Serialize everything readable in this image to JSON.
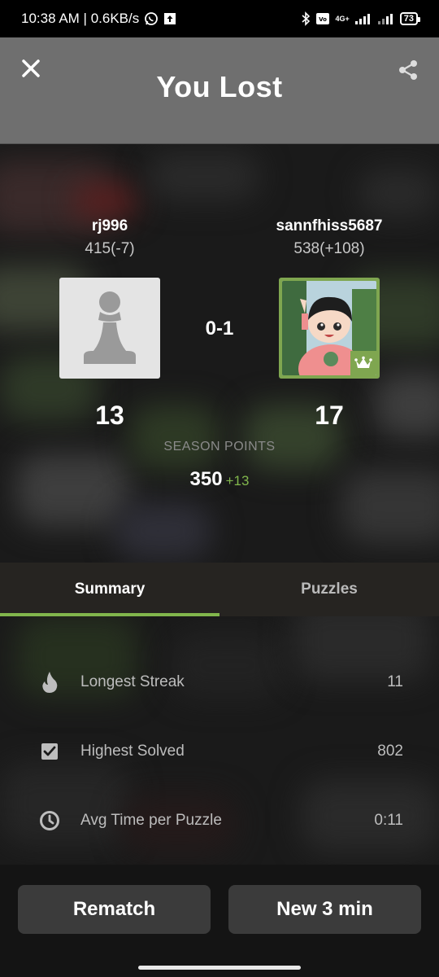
{
  "status_bar": {
    "time_speed": "10:38 AM | 0.6KB/s",
    "network": "4G+",
    "battery": "73"
  },
  "header": {
    "title": "You Lost"
  },
  "players": {
    "left": {
      "name": "rj996",
      "rating": "415(-7)",
      "points": "13",
      "avatar_icon": "pawn-icon"
    },
    "right": {
      "name": "sannfhiss5687",
      "rating": "538(+108)",
      "points": "17",
      "badge_icon": "crown-icon"
    }
  },
  "score": "0-1",
  "season": {
    "label": "SEASON POINTS",
    "value": "350",
    "delta": "+13"
  },
  "tabs": [
    {
      "label": "Summary",
      "active": true
    },
    {
      "label": "Puzzles",
      "active": false
    }
  ],
  "stats": [
    {
      "icon": "flame-icon",
      "label": "Longest Streak",
      "value": "11"
    },
    {
      "icon": "checkbox-icon",
      "label": "Highest Solved",
      "value": "802"
    },
    {
      "icon": "clock-icon",
      "label": "Avg Time per Puzzle",
      "value": "0:11"
    }
  ],
  "actions": {
    "rematch": "Rematch",
    "new_game": "New 3 min"
  },
  "colors": {
    "accent_green": "#81b64c",
    "header_bg": "#6f6f6f",
    "button_bg": "#3b3b3b"
  }
}
